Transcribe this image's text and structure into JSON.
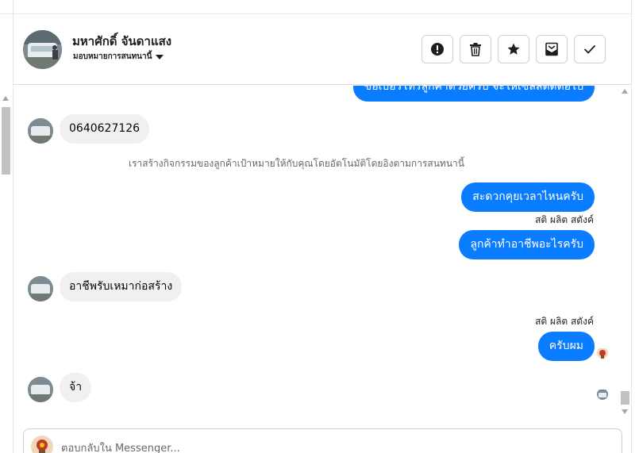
{
  "header": {
    "contact_name": "มหาศักดิ์ จันดาแสง",
    "assign_label": "มอบหมายการสนทนานี้",
    "actions": [
      {
        "icon": "alert-icon",
        "label": "Mark as spam"
      },
      {
        "icon": "trash-icon",
        "label": "Delete"
      },
      {
        "icon": "star-icon",
        "label": "Star"
      },
      {
        "icon": "mark-unread-icon",
        "label": "Mark as unread"
      },
      {
        "icon": "check-icon",
        "label": "Mark as done"
      }
    ]
  },
  "messages": {
    "m0_text": "ขอเบอร์โทรลูกค้าด้วยครับ จะให้เซลล์ติดต่อไป",
    "m1_text": "0640627126",
    "system_note": "เราสร้างกิจกรรมของลูกค้าเป้าหมายให้กับคุณโดยอัตโนมัติโดยอิงตามการสนทนานี้",
    "m2_text": "สะดวกคุยเวลาไหนครับ",
    "m3_sender": "สติ ผลิต สตังค์",
    "m3_text": "ลูกค้าทำอาชีพอะไรครับ",
    "m4_text": "อาชีพรับเหมาก่อสร้าง",
    "m5_sender": "สติ ผลิต สตังค์",
    "m5_text": "ครับผม",
    "m6_text": "จ้า"
  },
  "reply": {
    "placeholder": "ตอบกลับใน Messenger..."
  },
  "colors": {
    "outgoing_bubble": "#0a7cff",
    "incoming_bubble": "#f0f0f0",
    "border": "#ccd0d5"
  }
}
